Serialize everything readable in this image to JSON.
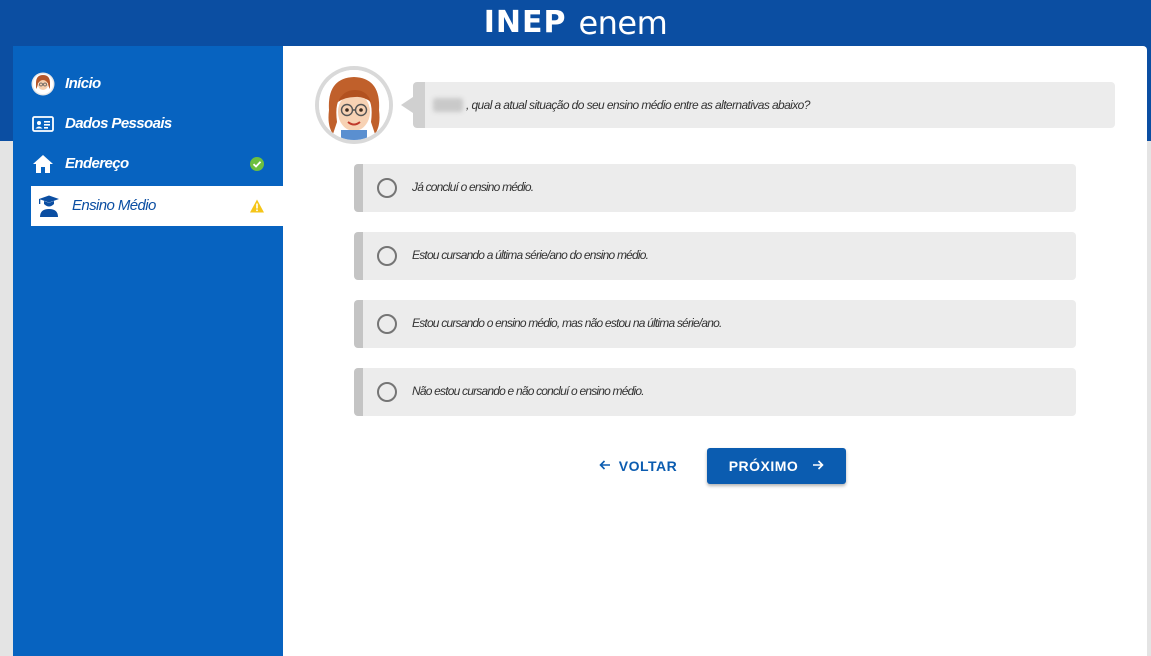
{
  "header": {
    "logo_inep": "INEP",
    "logo_enem": "enem"
  },
  "sidebar": {
    "items": [
      {
        "label": "Início",
        "icon": "user-avatar-icon",
        "status": ""
      },
      {
        "label": "Dados Pessoais",
        "icon": "id-card-icon",
        "status": ""
      },
      {
        "label": "Endereço",
        "icon": "home-icon",
        "status": "check"
      },
      {
        "label": "Ensino Médio",
        "icon": "graduate-icon",
        "status": "warning",
        "active": true
      }
    ]
  },
  "question": {
    "text": ", qual a atual situação do seu ensino médio entre as alternativas abaixo?"
  },
  "options": [
    "Já concluí o ensino médio.",
    "Estou cursando a última série/ano do ensino médio.",
    "Estou cursando o ensino médio, mas não estou na última série/ano.",
    "Não estou cursando e não concluí o ensino médio."
  ],
  "buttons": {
    "back": "VOLTAR",
    "next": "PRÓXIMO"
  },
  "colors": {
    "header_blue": "#0b4ea2",
    "sidebar_blue": "#0763c0",
    "button_blue": "#0b5cb0",
    "check_green": "#6cbf3f",
    "warning_yellow": "#f5c518"
  }
}
